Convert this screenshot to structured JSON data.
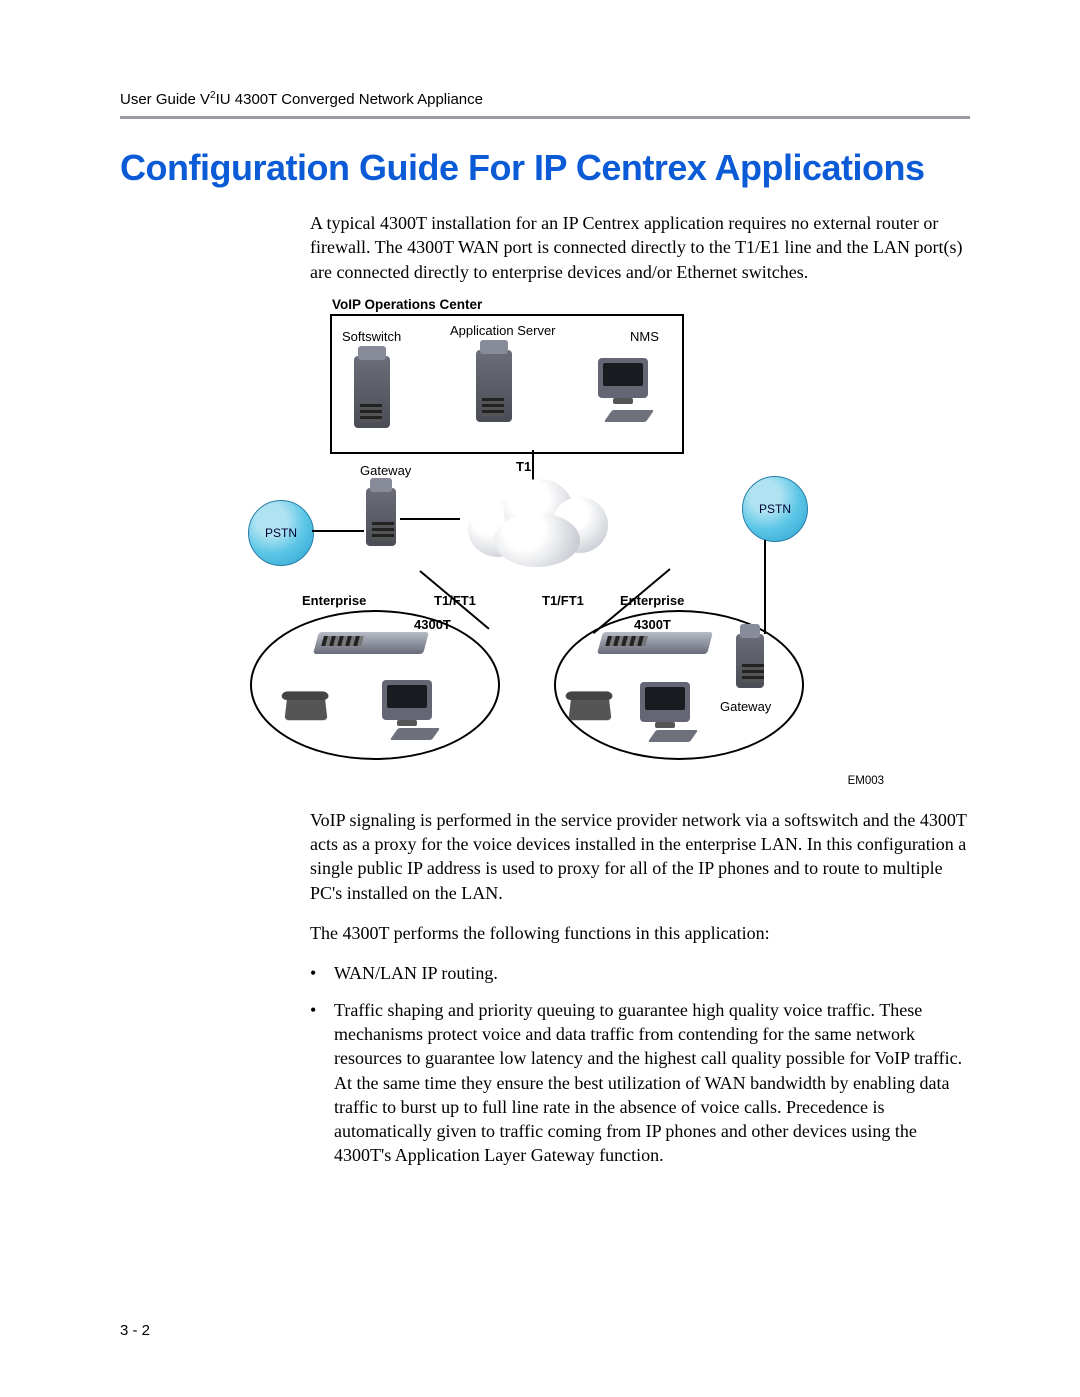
{
  "header": {
    "running_head": "User Guide V²IU 4300T Converged Network Appliance"
  },
  "title": "Configuration Guide For IP Centrex Applications",
  "intro_paragraph": "A typical 4300T installation for an IP Centrex application requires no external router or firewall.  The 4300T WAN port is connected directly to the T1/E1 line and the LAN port(s) are connected directly to enterprise devices and/or Ethernet switches.",
  "diagram": {
    "ops_center_title": "VoIP Operations Center",
    "labels": {
      "softswitch": "Softswitch",
      "app_server": "Application Server",
      "nms": "NMS",
      "gateway_center": "Gateway",
      "gateway_right": "Gateway",
      "pstn_left": "PSTN",
      "pstn_right": "PSTN",
      "t1": "T1",
      "t1ft1_left": "T1/FT1",
      "t1ft1_right": "T1/FT1",
      "enterprise_left": "Enterprise",
      "enterprise_right": "Enterprise",
      "device_left": "4300T",
      "device_right": "4300T",
      "code": "EM003"
    }
  },
  "paragraph_signaling": "VoIP signaling is performed in the service provider network via a softswitch and the 4300T acts as a proxy for the voice devices installed in the enterprise LAN.  In this configuration a single public IP address is used to proxy for all of the IP phones and to route to multiple PC's installed on the LAN.",
  "paragraph_functions_intro": "The 4300T performs the following functions in this application:",
  "bullets": {
    "b1": "WAN/LAN IP routing.",
    "b2": "Traffic shaping and priority queuing to guarantee high quality voice traffic.  These mechanisms protect voice and data traffic from contending for the same network resources to guarantee low latency and the highest call quality possible for VoIP traffic.  At the same time they ensure the best utilization of WAN bandwidth by enabling data traffic to burst up to full line rate in the absence of voice calls.  Precedence is automatically given to traffic coming from IP phones and other devices using the 4300T's Application Layer Gateway function."
  },
  "page_number": "3 - 2"
}
